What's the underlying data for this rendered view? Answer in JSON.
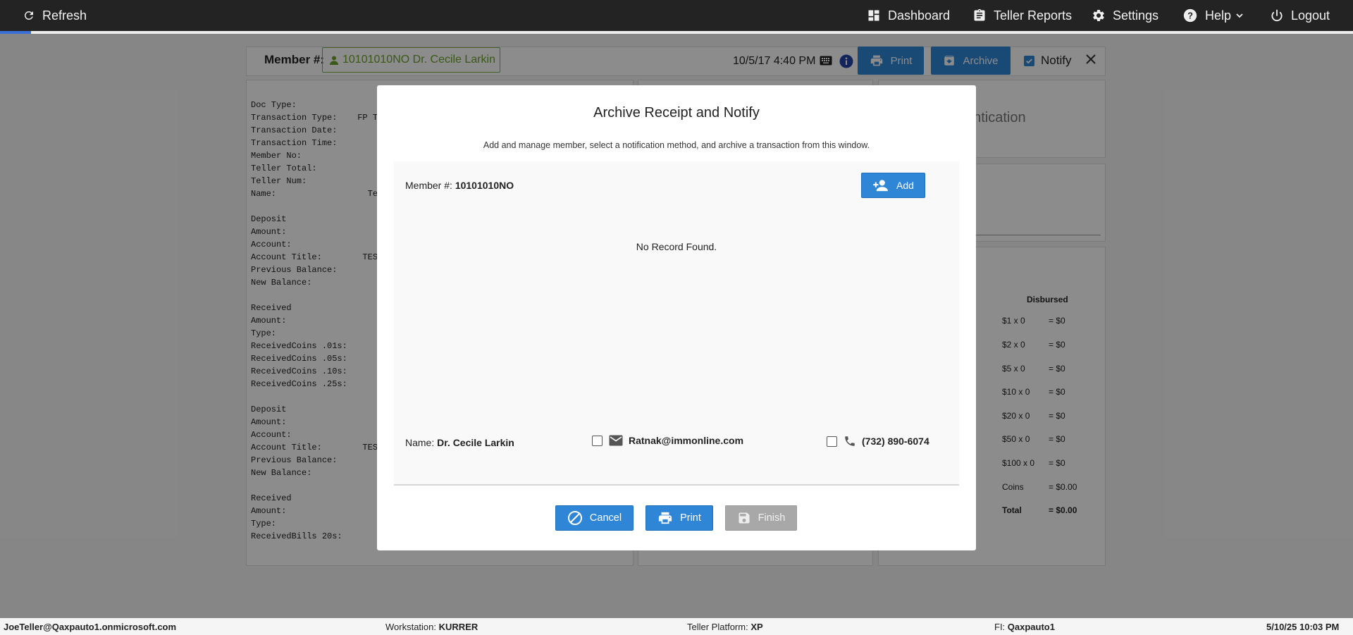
{
  "topbar": {
    "refresh": "Refresh",
    "dashboard": "Dashboard",
    "teller_reports": "Teller Reports",
    "settings": "Settings",
    "help": "Help",
    "logout": "Logout"
  },
  "member_bar": {
    "label": "Member #:",
    "member_value": "10101010NO Dr. Cecile Larkin",
    "datetime": "10/5/17 4:40 PM",
    "print": "Print",
    "archive": "Archive",
    "notify": "Notify",
    "notify_checked": true
  },
  "receipt_lines": [
    "Doc Type:",
    "Transaction Type:    FP TRA",
    "Transaction Date:",
    "Transaction Time:",
    "Member No:               **",
    "Teller Total:",
    "Teller Num:",
    "Name:                  Test",
    "",
    "Deposit",
    "Amount:",
    "Account:                 **",
    "Account Title:        TEST",
    "Previous Balance:",
    "New Balance:",
    "",
    "Received",
    "Amount:",
    "Type:",
    "ReceivedCoins .01s:",
    "ReceivedCoins .05s:",
    "ReceivedCoins .10s:",
    "ReceivedCoins .25s:",
    "",
    "Deposit",
    "Amount:",
    "Account:                 **",
    "Account Title:        TEST",
    "Previous Balance:",
    "New Balance:",
    "",
    "Received",
    "Amount:",
    "Type:",
    "ReceivedBills 20s:"
  ],
  "right_panel": {
    "heading_partial": "entication",
    "disbursed_title": "Disbursed",
    "rows": [
      {
        "denom": "$1 x 0",
        "amount": "= $0"
      },
      {
        "denom": "$2 x 0",
        "amount": "= $0"
      },
      {
        "denom": "$5 x 0",
        "amount": "= $0"
      },
      {
        "denom": "$10 x 0",
        "amount": "= $0"
      },
      {
        "denom": "$20 x 0",
        "amount": "= $0"
      },
      {
        "denom": "$50 x 0",
        "amount": "= $0"
      },
      {
        "denom": "$100 x 0",
        "amount": "= $0"
      },
      {
        "denom": "Coins",
        "amount": "= $0.00"
      },
      {
        "denom": "Total",
        "amount": "= $0.00"
      }
    ]
  },
  "modal": {
    "title": "Archive Receipt and Notify",
    "subtitle": "Add and manage member, select a notification method, and archive a transaction from this window.",
    "member_label": "Member #:",
    "member_value": "10101010NO",
    "add_button": "Add",
    "no_record": "No Record Found.",
    "name_label": "Name:",
    "name_value": "Dr. Cecile Larkin",
    "email": "Ratnak@immonline.com",
    "phone": "(732) 890-6074",
    "cancel_button": "Cancel",
    "print_button": "Print",
    "finish_button": "Finish"
  },
  "footer": {
    "user": "JoeTeller@Qaxpauto1.onmicrosoft.com",
    "workstation_label": "Workstation:",
    "workstation_value": "KURRER",
    "platform_label": "Teller Platform:",
    "platform_value": "XP",
    "fi_label": "FI:",
    "fi_value": "Qaxpauto1",
    "datetime": "5/10/25 10:03 PM"
  },
  "colors": {
    "topbar": "#232323",
    "primary_button": "#2f86d6",
    "member_chip": "#7cb342",
    "disabled_button": "#a8a8a8"
  }
}
